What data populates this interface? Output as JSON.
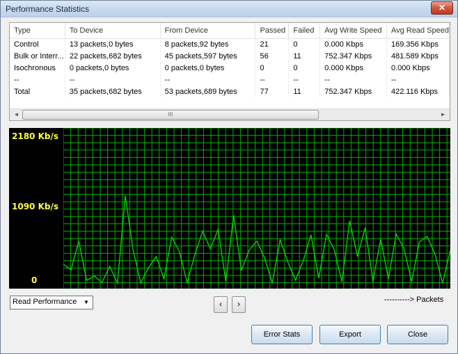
{
  "window": {
    "title": "Performance Statistics",
    "close_label": "✕"
  },
  "table": {
    "columns": [
      "Type",
      "To Device",
      "From Device",
      "Passed",
      "Failed",
      "Avg Write Speed",
      "Avg Read Speed"
    ],
    "rows": [
      [
        "Control",
        "13 packets,0 bytes",
        "8 packets,92 bytes",
        "21",
        "0",
        "0.000 Kbps",
        "169.356 Kbps"
      ],
      [
        "Bulk or Interr...",
        "22 packets,682 bytes",
        "45 packets,597 bytes",
        "56",
        "11",
        "752.347 Kbps",
        "481.589 Kbps"
      ],
      [
        "Isochronous",
        "0 packets,0 bytes",
        "0 packets,0 bytes",
        "0",
        "0",
        "0.000 Kbps",
        "0.000 Kbps"
      ],
      [
        "--",
        "--",
        "--",
        "--",
        "--",
        "--",
        "--"
      ],
      [
        "Total",
        "35 packets,682 bytes",
        "53 packets,689 bytes",
        "77",
        "11",
        "752.347 Kbps",
        "422.116 Kbps"
      ]
    ],
    "scroll_left": "◄",
    "scroll_right": "►",
    "thumb_grip": "III"
  },
  "graph": {
    "y_labels": {
      "max": "2180 Kb/s",
      "mid": "1090 Kb/s",
      "min": "0"
    },
    "legend": "----------> Packets",
    "line_color": "#00e000",
    "grid_color": "#00b000",
    "y_max": 2180,
    "values": [
      310,
      230,
      640,
      80,
      140,
      50,
      280,
      40,
      1290,
      520,
      40,
      260,
      420,
      100,
      700,
      490,
      40,
      450,
      780,
      530,
      810,
      60,
      1010,
      220,
      510,
      640,
      400,
      40,
      660,
      340,
      80,
      360,
      730,
      110,
      740,
      520,
      60,
      930,
      420,
      830,
      60,
      670,
      100,
      740,
      540,
      60,
      630,
      710,
      460,
      40,
      510
    ]
  },
  "controls": {
    "mode_value": "Read Performance",
    "mode_arrow": "▼",
    "prev_label": "‹",
    "next_label": "›"
  },
  "buttons": {
    "error_stats": "Error Stats",
    "export": "Export",
    "close": "Close"
  }
}
